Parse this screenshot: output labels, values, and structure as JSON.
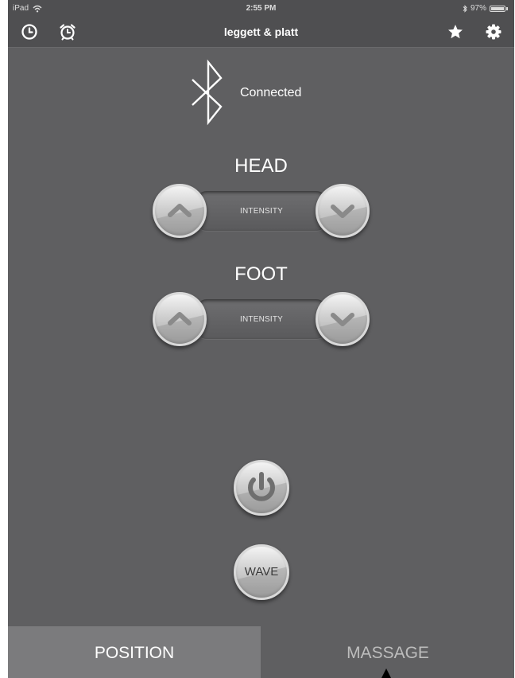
{
  "status_bar": {
    "device": "iPad",
    "time": "2:55 PM",
    "battery_percent": "97%",
    "battery_level": 0.97,
    "icons": [
      "wifi-icon",
      "bluetooth-icon",
      "battery-icon"
    ]
  },
  "nav": {
    "title": "leggett & platt",
    "icons": [
      "clock-icon",
      "alarm-clock-icon",
      "star-icon",
      "gear-icon"
    ]
  },
  "connection": {
    "status": "Connected",
    "icon": "bluetooth-icon"
  },
  "head": {
    "label": "HEAD",
    "intensity_label": "INTENSITY",
    "icons": [
      "chevron-up-icon",
      "chevron-down-icon"
    ]
  },
  "foot": {
    "label": "FOOT",
    "intensity_label": "INTENSITY",
    "icons": [
      "chevron-up-icon",
      "chevron-down-icon"
    ]
  },
  "controls": {
    "power_icon": "power-icon",
    "wave_label": "WAVE"
  },
  "tabs": [
    {
      "label": "POSITION",
      "active": false
    },
    {
      "label": "MASSAGE",
      "active": true
    }
  ],
  "colors": {
    "background": "#5f5f61",
    "bar": "#4f4f51",
    "tab_position": "#7b7b7d",
    "button_face": "#d9d9d9"
  }
}
